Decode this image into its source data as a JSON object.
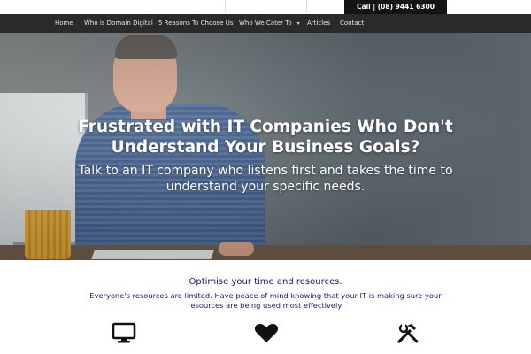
{
  "topbar": {
    "call_label": "Call | (08) 9441 6300"
  },
  "nav": {
    "items": [
      {
        "label": "Home"
      },
      {
        "label": "Who is Domain Digital"
      },
      {
        "label": "5 Reasons To Choose Us"
      },
      {
        "label": "Who We Cater To",
        "caret": "▾"
      },
      {
        "label": "Articles"
      },
      {
        "label": "Contact"
      }
    ]
  },
  "hero": {
    "title": "Frustrated with IT Companies Who Don't Understand Your Business Goals?",
    "subtitle": "Talk to an IT company who listens first and takes the time to understand your specific needs."
  },
  "section": {
    "title": "Optimise your time and resources.",
    "text": "Everyone's resources are limited. Have peace of mind knowing that your IT is making sure your resources are being used most effectively."
  },
  "features": {
    "icons": [
      "monitor-icon",
      "heart-icon",
      "tools-icon"
    ]
  },
  "colors": {
    "nav_bg": "#2a2a2a",
    "call_bg": "#141414",
    "text_accent": "#1a1570"
  }
}
